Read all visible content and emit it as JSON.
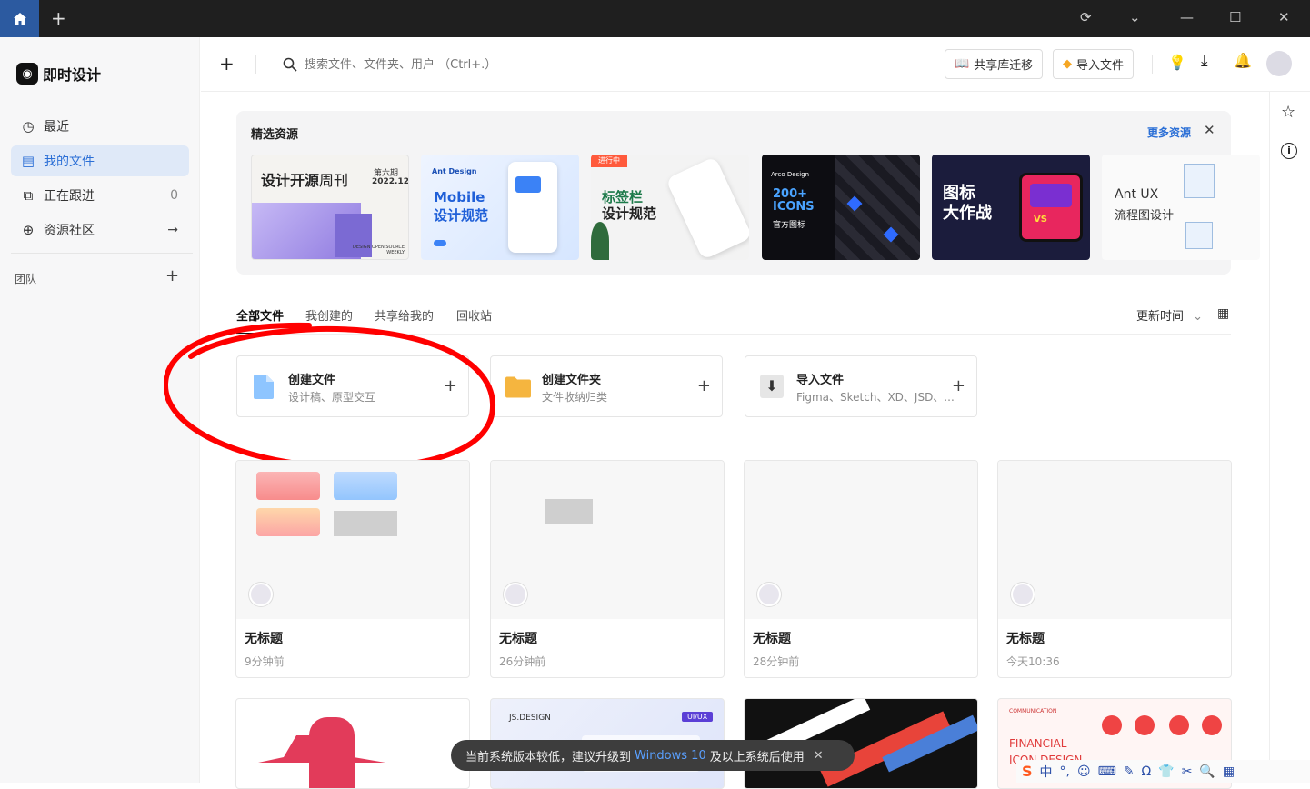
{
  "titlebar": {
    "home_icon": "home-icon",
    "new_tab_icon": "plus-icon"
  },
  "app": {
    "name": "即时设计"
  },
  "sidebar": {
    "items": [
      {
        "label": "最近",
        "icon": "clock-icon",
        "extra": ""
      },
      {
        "label": "我的文件",
        "icon": "file-icon",
        "extra": ""
      },
      {
        "label": "正在跟进",
        "icon": "bookmark-icon",
        "extra": "0"
      },
      {
        "label": "资源社区",
        "icon": "globe-icon",
        "extra": "→"
      }
    ],
    "team_label": "团队"
  },
  "search": {
    "placeholder": "搜索文件、文件夹、用户 （Ctrl+.）"
  },
  "header_buttons": {
    "share_migrate": "共享库迁移",
    "import_file": "导入文件"
  },
  "featured": {
    "title": "精选资源",
    "more": "更多资源",
    "cards": [
      {
        "t1": "设计开源",
        "t2": "周刊",
        "t3": "第六期",
        "t4": "2022.12",
        "t5": "DESIGN OPEN SOURCE WEEKLY"
      },
      {
        "t1": "Ant Design",
        "t2": "Mobile",
        "t3": "设计规范"
      },
      {
        "t1": "进行中",
        "t2": "标签栏",
        "t3": "设计规范"
      },
      {
        "t1": "Arco Design",
        "t2": "200+",
        "t3": "ICONS",
        "t4": "官方图标"
      },
      {
        "t1": "图标",
        "t2": "大作战"
      },
      {
        "t1": "Ant UX",
        "t2": "流程图设计"
      }
    ]
  },
  "tabs": [
    "全部文件",
    "我创建的",
    "共享给我的",
    "回收站"
  ],
  "sort_label": "更新时间",
  "actions": [
    {
      "title": "创建文件",
      "sub": "设计稿、原型交互"
    },
    {
      "title": "创建文件夹",
      "sub": "文件收纳归类"
    },
    {
      "title": "导入文件",
      "sub": "Figma、Sketch、XD、JSD、..."
    }
  ],
  "files": [
    {
      "title": "无标题",
      "time": "9分钟前"
    },
    {
      "title": "无标题",
      "time": "26分钟前"
    },
    {
      "title": "无标题",
      "time": "28分钟前"
    },
    {
      "title": "无标题",
      "time": "今天10:36"
    }
  ],
  "bottom_cards": [
    {
      "label": ""
    },
    {
      "label": "JS.DESIGN",
      "tag": "UI/UX"
    },
    {
      "label": ""
    },
    {
      "label": "FINANCIAL",
      "label2": "ICON DESIGN",
      "top": "COMMUNICATION"
    }
  ],
  "toast": {
    "text1": "当前系统版本较低，建议升级到",
    "highlight": "Windows 10",
    "text2": "及以上系统后使用"
  },
  "ime": {
    "lang": "中"
  }
}
